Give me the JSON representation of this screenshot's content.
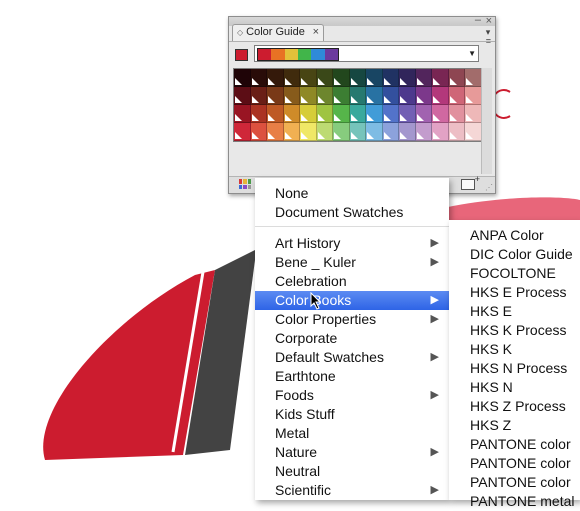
{
  "panel": {
    "title": "Color Guide",
    "base_color": "#cc1c2f",
    "harmony_colors": [
      "#cc1c2f",
      "#e87224",
      "#e3c13a",
      "#41b54a",
      "#2f8ad8",
      "#6b3a9e"
    ],
    "grid_columns": [
      "#cc1c2f",
      "#d9402c",
      "#e56c2b",
      "#eea02f",
      "#ece23f",
      "#a8cf45",
      "#57b84b",
      "#34a79a",
      "#3495d5",
      "#3f63c4",
      "#5b44a7",
      "#8c3f9e",
      "#c23d86",
      "#d76a7c",
      "#e79a99"
    ],
    "icons": {
      "library": "swatch-library-icon",
      "new_group": "new-swatch-group-icon",
      "menu": "panel-menu-icon"
    }
  },
  "main_menu": {
    "items": [
      {
        "label": "None",
        "submenu": false
      },
      {
        "label": "Document Swatches",
        "submenu": false
      },
      {
        "label": "Art History",
        "submenu": true
      },
      {
        "label": "Bene _ Kuler",
        "submenu": true
      },
      {
        "label": "Celebration",
        "submenu": false
      },
      {
        "label": "Color Books",
        "submenu": true
      },
      {
        "label": "Color Properties",
        "submenu": true
      },
      {
        "label": "Corporate",
        "submenu": false
      },
      {
        "label": "Default Swatches",
        "submenu": true
      },
      {
        "label": "Earthtone",
        "submenu": false
      },
      {
        "label": "Foods",
        "submenu": true
      },
      {
        "label": "Kids Stuff",
        "submenu": false
      },
      {
        "label": "Metal",
        "submenu": false
      },
      {
        "label": "Nature",
        "submenu": true
      },
      {
        "label": "Neutral",
        "submenu": false
      },
      {
        "label": "Scientific",
        "submenu": true
      }
    ],
    "highlighted": "Color Books"
  },
  "sub_menu": {
    "items": [
      "ANPA Color",
      "DIC Color Guide",
      "FOCOLTONE",
      "HKS E Process",
      "HKS E",
      "HKS K Process",
      "HKS K",
      "HKS N Process",
      "HKS N",
      "HKS Z Process",
      "HKS Z",
      "PANTONE color",
      "PANTONE color",
      "PANTONE color",
      "PANTONE metal"
    ]
  }
}
